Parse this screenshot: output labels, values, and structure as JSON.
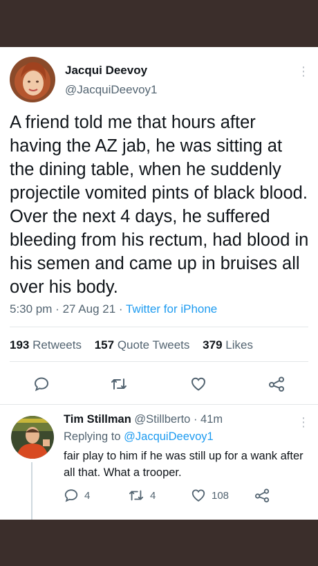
{
  "tweet": {
    "author_name": "Jacqui Deevoy",
    "author_handle": "@JacquiDeevoy1",
    "text": "A friend told me that hours after having the AZ jab, he was sitting at the dining table, when he suddenly projectile vomited pints of black blood. Over the next 4 days, he suffered bleeding from his rectum, had blood in his semen and came up in bruises all over his body.",
    "time": "5:30 pm",
    "date": "27 Aug 21",
    "separator": "·",
    "source": "Twitter for iPhone",
    "more_glyph": "⋮",
    "stats": {
      "retweets_count": "193",
      "retweets_label": "Retweets",
      "quotes_count": "157",
      "quotes_label": "Quote Tweets",
      "likes_count": "379",
      "likes_label": "Likes"
    },
    "actions": [
      "reply-icon",
      "retweet-icon",
      "like-icon",
      "share-icon"
    ]
  },
  "reply": {
    "author_name": "Tim Stillman",
    "author_handle": "@Stillberto",
    "separator": "·",
    "age": "41m",
    "replying_prefix": "Replying to",
    "replying_to": "@JacquiDeevoy1",
    "text": "fair play to him if he was still up for a wank after all that. What a trooper.",
    "more_glyph": "⋮",
    "counts": {
      "replies": "4",
      "retweets": "4",
      "likes": "108"
    }
  },
  "colors": {
    "link": "#1d9bf0",
    "muted": "#536471",
    "text": "#0f1419",
    "page_background": "#3b2e2b"
  }
}
